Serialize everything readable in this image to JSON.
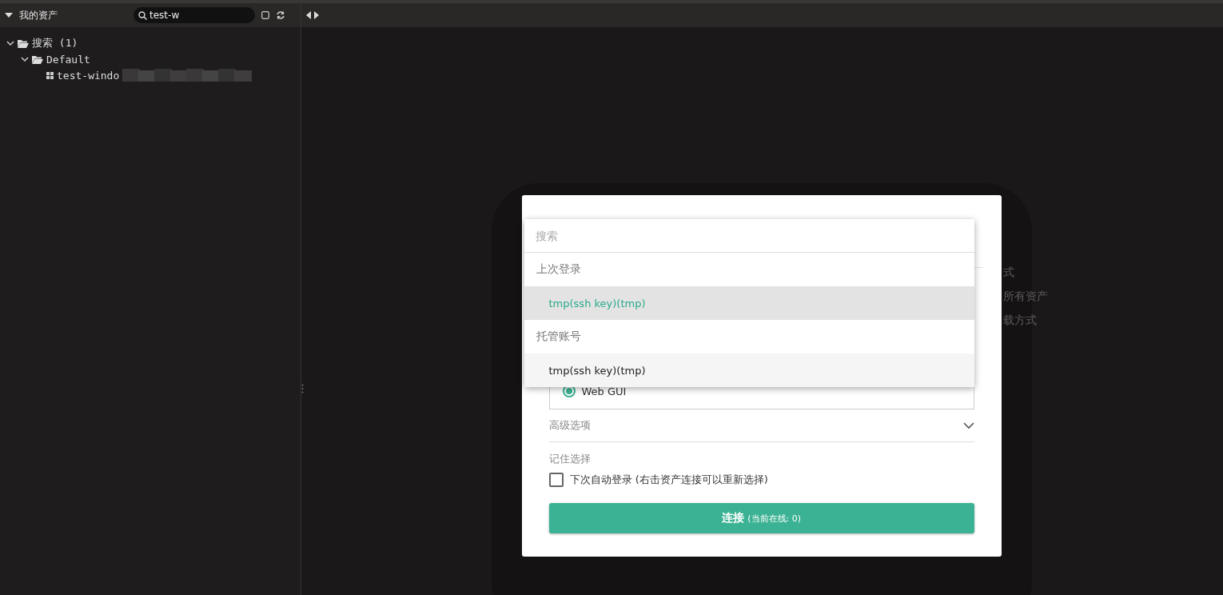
{
  "sidebar": {
    "title": "我的资产",
    "search": {
      "value": "test-w"
    },
    "tree": [
      {
        "label": "搜索 (1)",
        "kind": "folder",
        "expanded": true,
        "children": [
          {
            "label": "Default",
            "kind": "folder",
            "expanded": true,
            "children": [
              {
                "label": "test-windo",
                "kind": "asset",
                "redacted": true
              }
            ]
          }
        ]
      }
    ]
  },
  "background_hints": [
    "式",
    "所有资产",
    "载方式"
  ],
  "dialog": {
    "dropdown": {
      "placeholder": "搜索",
      "groups": [
        {
          "title": "上次登录",
          "items": [
            {
              "label": "tmp(ssh key)(tmp)",
              "selected": true
            }
          ]
        },
        {
          "title": "托管账号",
          "items": [
            {
              "label": "tmp(ssh key)(tmp)",
              "selected": false
            }
          ]
        }
      ]
    },
    "mode": {
      "label": "Web GUI",
      "selected": true
    },
    "advanced": {
      "label": "高级选项",
      "expanded": false
    },
    "remember_label": "记住选择",
    "auto_login": {
      "label": "下次自动登录 (右击资产连接可以重新选择)",
      "checked": false
    },
    "connect_button": {
      "label": "连接",
      "note": "(当前在线: 0)"
    }
  }
}
